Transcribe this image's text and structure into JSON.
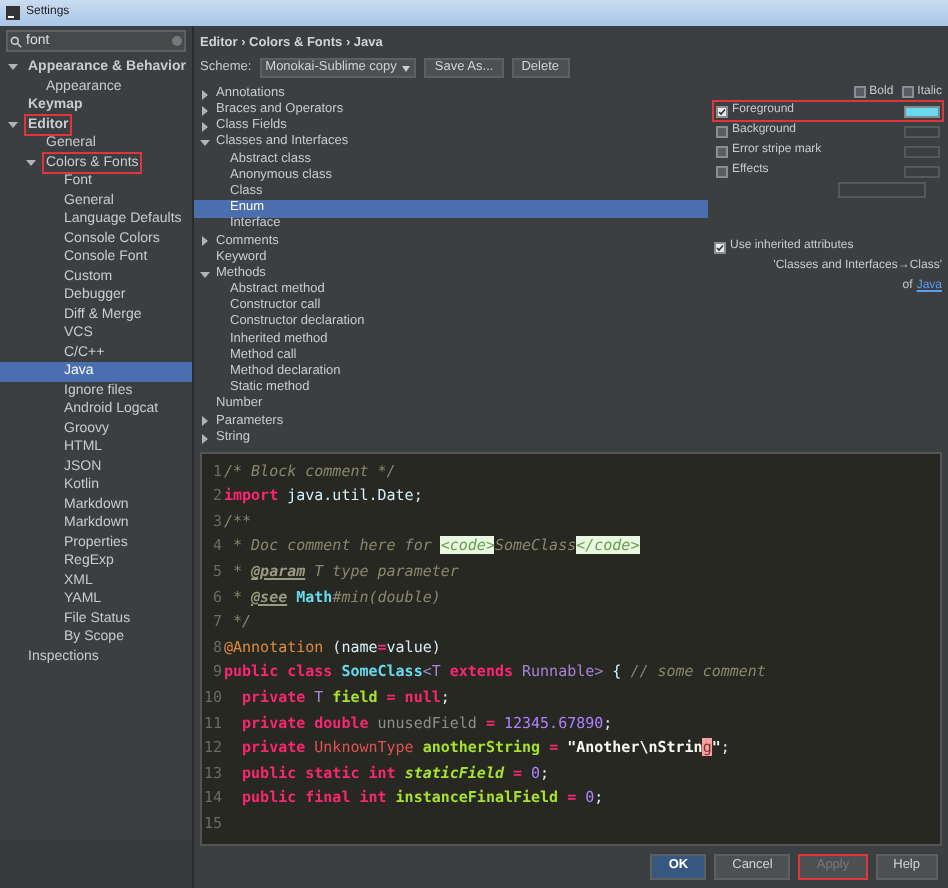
{
  "window": {
    "title": "Settings"
  },
  "search": {
    "value": "font"
  },
  "sidebar": {
    "items": [
      {
        "label": "Appearance & Behavior",
        "bold": true,
        "expanded": true,
        "highlighted": false,
        "selected": false,
        "children": [
          {
            "label": "Appearance",
            "bold": false,
            "highlighted": false,
            "selected": false
          }
        ]
      },
      {
        "label": "Keymap",
        "bold": true,
        "highlighted": false,
        "selected": false
      },
      {
        "label": "Editor",
        "bold": true,
        "expanded": true,
        "highlighted": true,
        "selected": false,
        "children": [
          {
            "label": "General",
            "bold": false,
            "highlighted": false,
            "selected": false
          },
          {
            "label": "Colors & Fonts",
            "bold": false,
            "expanded": true,
            "highlighted": true,
            "selected": false,
            "children": [
              {
                "label": "Font",
                "bold": false,
                "highlighted": false,
                "selected": false
              },
              {
                "label": "General",
                "bold": false,
                "highlighted": false,
                "selected": false
              },
              {
                "label": "Language Defaults",
                "bold": false,
                "highlighted": false,
                "selected": false
              },
              {
                "label": "Console Colors",
                "bold": false,
                "highlighted": false,
                "selected": false
              },
              {
                "label": "Console Font",
                "bold": false,
                "highlighted": false,
                "selected": false
              },
              {
                "label": "Custom",
                "bold": false,
                "highlighted": false,
                "selected": false
              },
              {
                "label": "Debugger",
                "bold": false,
                "highlighted": false,
                "selected": false
              },
              {
                "label": "Diff & Merge",
                "bold": false,
                "highlighted": false,
                "selected": false
              },
              {
                "label": "VCS",
                "bold": false,
                "highlighted": false,
                "selected": false
              },
              {
                "label": "C/C++",
                "bold": false,
                "highlighted": false,
                "selected": false
              },
              {
                "label": "Java",
                "bold": false,
                "highlighted": false,
                "selected": true
              },
              {
                "label": "Ignore files",
                "bold": false,
                "highlighted": false,
                "selected": false
              },
              {
                "label": "Android Logcat",
                "bold": false,
                "highlighted": false,
                "selected": false
              },
              {
                "label": "Groovy",
                "bold": false,
                "highlighted": false,
                "selected": false
              },
              {
                "label": "HTML",
                "bold": false,
                "highlighted": false,
                "selected": false
              },
              {
                "label": "JSON",
                "bold": false,
                "highlighted": false,
                "selected": false
              },
              {
                "label": "Kotlin",
                "bold": false,
                "highlighted": false,
                "selected": false
              },
              {
                "label": "Markdown",
                "bold": false,
                "highlighted": false,
                "selected": false
              },
              {
                "label": "Markdown",
                "bold": false,
                "highlighted": false,
                "selected": false
              },
              {
                "label": "Properties",
                "bold": false,
                "highlighted": false,
                "selected": false
              },
              {
                "label": "RegExp",
                "bold": false,
                "highlighted": false,
                "selected": false
              },
              {
                "label": "XML",
                "bold": false,
                "highlighted": false,
                "selected": false
              },
              {
                "label": "YAML",
                "bold": false,
                "highlighted": false,
                "selected": false
              },
              {
                "label": "File Status",
                "bold": false,
                "highlighted": false,
                "selected": false
              },
              {
                "label": "By Scope",
                "bold": false,
                "highlighted": false,
                "selected": false
              }
            ]
          }
        ]
      },
      {
        "label": "Inspections",
        "bold": false,
        "highlighted": false,
        "selected": false
      }
    ]
  },
  "breadcrumb": "Editor › Colors & Fonts › Java",
  "scheme": {
    "label": "Scheme:",
    "value": "Monokai-Sublime copy",
    "buttons": [
      "Save As...",
      "Delete"
    ]
  },
  "tree": [
    {
      "label": "Annotations",
      "expanded": false,
      "selected": false
    },
    {
      "label": "Braces and Operators",
      "expanded": false,
      "selected": false
    },
    {
      "label": "Class Fields",
      "expanded": false,
      "selected": false
    },
    {
      "label": "Classes and Interfaces",
      "expanded": true,
      "selected": false,
      "children": [
        {
          "label": "Abstract class",
          "selected": false
        },
        {
          "label": "Anonymous class",
          "selected": false
        },
        {
          "label": "Class",
          "selected": false
        },
        {
          "label": "Enum",
          "selected": true
        },
        {
          "label": "Interface",
          "selected": false
        }
      ]
    },
    {
      "label": "Comments",
      "expanded": false,
      "selected": false
    },
    {
      "label": "Keyword",
      "selected": false
    },
    {
      "label": "Methods",
      "expanded": true,
      "selected": false,
      "children": [
        {
          "label": "Abstract method",
          "selected": false
        },
        {
          "label": "Constructor call",
          "selected": false
        },
        {
          "label": "Constructor declaration",
          "selected": false
        },
        {
          "label": "Inherited method",
          "selected": false
        },
        {
          "label": "Method call",
          "selected": false
        },
        {
          "label": "Method declaration",
          "selected": false
        },
        {
          "label": "Static method",
          "selected": false
        }
      ]
    },
    {
      "label": "Number",
      "selected": false
    },
    {
      "label": "Parameters",
      "expanded": false,
      "selected": false
    },
    {
      "label": "String",
      "expanded": false,
      "selected": false
    }
  ],
  "attributes": {
    "styles": [
      {
        "label": "Bold",
        "checked": false
      },
      {
        "label": "Italic",
        "checked": false
      }
    ],
    "options": [
      {
        "label": "Foreground",
        "checked": true,
        "highlighted": true,
        "color": "#66d9ef"
      },
      {
        "label": "Background",
        "checked": false,
        "highlighted": false
      },
      {
        "label": "Error stripe mark",
        "checked": false,
        "highlighted": false
      },
      {
        "label": "Effects",
        "checked": false,
        "highlighted": false
      }
    ],
    "inherit": {
      "label": "Use inherited attributes",
      "checked": true,
      "source": "'Classes and Interfaces→Class'",
      "of": "of",
      "link": "Java"
    }
  },
  "code": [
    {
      "number": "1",
      "tokens": [
        {
          "text": "/* Block comment */",
          "kind": "comment"
        }
      ]
    },
    {
      "number": "2",
      "tokens": [
        {
          "text": "import",
          "kind": "keyword"
        },
        {
          "text": " java.util.Date;",
          "kind": "plain"
        }
      ]
    },
    {
      "number": "3",
      "tokens": [
        {
          "text": "/**",
          "kind": "comment"
        }
      ]
    },
    {
      "number": "4",
      "tokens": [
        {
          "text": " * Doc comment here for ",
          "kind": "comment"
        },
        {
          "text": "<code>",
          "kind": "codetag"
        },
        {
          "text": "SomeClass",
          "kind": "comment"
        },
        {
          "text": "</code>",
          "kind": "codetag"
        }
      ]
    },
    {
      "number": "5",
      "tokens": [
        {
          "text": " * ",
          "kind": "comment"
        },
        {
          "text": "@param",
          "kind": "doctag"
        },
        {
          "text": " T type parameter",
          "kind": "comment"
        }
      ]
    },
    {
      "number": "6",
      "tokens": [
        {
          "text": " * ",
          "kind": "comment"
        },
        {
          "text": "@see",
          "kind": "doctag"
        },
        {
          "text": " Math",
          "kind": "type"
        },
        {
          "text": "#min(double)",
          "kind": "comment"
        }
      ]
    },
    {
      "number": "7",
      "tokens": [
        {
          "text": " */",
          "kind": "comment"
        }
      ]
    },
    {
      "number": "8",
      "tokens": [
        {
          "text": "@Annotation",
          "kind": "annotation"
        },
        {
          "text": " (name",
          "kind": "plain"
        },
        {
          "text": "=",
          "kind": "keyword"
        },
        {
          "text": "value)",
          "kind": "plain"
        }
      ]
    },
    {
      "number": "9",
      "tokens": [
        {
          "text": "public class ",
          "kind": "keyword"
        },
        {
          "text": "SomeClass",
          "kind": "type"
        },
        {
          "text": "<T ",
          "kind": "param"
        },
        {
          "text": "extends ",
          "kind": "keyword"
        },
        {
          "text": "Runnable> ",
          "kind": "param"
        },
        {
          "text": "{ ",
          "kind": "plain"
        },
        {
          "text": "// some comment",
          "kind": "comment"
        }
      ]
    },
    {
      "number": "10",
      "tokens": [
        {
          "text": "  private ",
          "kind": "keyword"
        },
        {
          "text": "T",
          "kind": "param"
        },
        {
          "text": " field ",
          "kind": "field"
        },
        {
          "text": "= null",
          "kind": "keyword"
        },
        {
          "text": ";",
          "kind": "plain"
        }
      ]
    },
    {
      "number": "11",
      "tokens": [
        {
          "text": "  private double ",
          "kind": "keyword"
        },
        {
          "text": "unusedField",
          "kind": "unused"
        },
        {
          "text": " = ",
          "kind": "keyword"
        },
        {
          "text": "12345.67890",
          "kind": "number"
        },
        {
          "text": ";",
          "kind": "plain"
        }
      ]
    },
    {
      "number": "12",
      "tokens": [
        {
          "text": "  private ",
          "kind": "keyword"
        },
        {
          "text": "UnknownType",
          "kind": "unknown"
        },
        {
          "text": " anotherString ",
          "kind": "field"
        },
        {
          "text": "= ",
          "kind": "keyword"
        },
        {
          "text": "\"Another\\nStrin",
          "kind": "string"
        },
        {
          "text": "g",
          "kind": "error"
        },
        {
          "text": "\"",
          "kind": "string"
        },
        {
          "text": ";",
          "kind": "plain"
        }
      ]
    },
    {
      "number": "13",
      "tokens": [
        {
          "text": "  public static int ",
          "kind": "keyword"
        },
        {
          "text": "staticField",
          "kind": "static"
        },
        {
          "text": " = ",
          "kind": "keyword"
        },
        {
          "text": "0",
          "kind": "number"
        },
        {
          "text": ";",
          "kind": "plain"
        }
      ]
    },
    {
      "number": "14",
      "tokens": [
        {
          "text": "  public final int ",
          "kind": "keyword"
        },
        {
          "text": "instanceFinalField",
          "kind": "field"
        },
        {
          "text": " = ",
          "kind": "keyword"
        },
        {
          "text": "0",
          "kind": "number"
        },
        {
          "text": ";",
          "kind": "plain"
        }
      ]
    },
    {
      "number": "15"
    }
  ],
  "buttons": [
    {
      "label": "OK",
      "kind": "default",
      "highlighted": false
    },
    {
      "label": "Cancel",
      "kind": "normal",
      "highlighted": false
    },
    {
      "label": "Apply",
      "kind": "disabled",
      "highlighted": true
    },
    {
      "label": "Help",
      "kind": "normal",
      "highlighted": false
    }
  ]
}
